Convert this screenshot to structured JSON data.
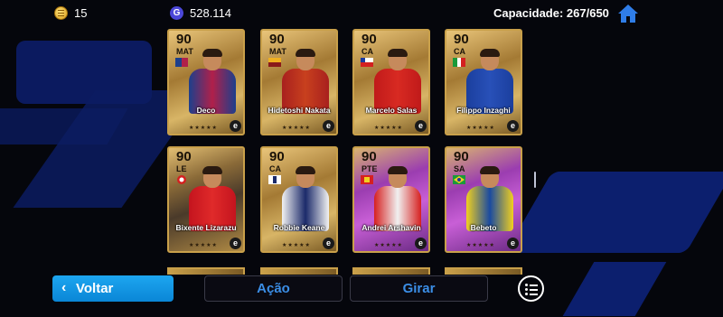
{
  "currency": {
    "coins": "15",
    "gp": "528.114",
    "gp_icon_label": "G"
  },
  "capacity": "Capacidade: 267/650",
  "cards": [
    {
      "rating": "90",
      "position": "MAT",
      "name": "Deco",
      "flag": "barcelona-crest",
      "jersey": "#1d3f8c",
      "jersey2": "#b0204a",
      "style": "gold"
    },
    {
      "rating": "90",
      "position": "MAT",
      "name": "Hidetoshi Nakata",
      "flag": "roma-crest",
      "jersey": "#a8201e",
      "jersey2": "#c8401e",
      "style": "gold"
    },
    {
      "rating": "90",
      "position": "CA",
      "name": "Marcelo Salas",
      "flag": "chile",
      "jersey": "#c01a1a",
      "jersey2": "#d82a22",
      "style": "gold"
    },
    {
      "rating": "90",
      "position": "CA",
      "name": "Filippo Inzaghi",
      "flag": "italy",
      "jersey": "#1b3f9e",
      "jersey2": "#2850b8",
      "style": "gold"
    },
    {
      "rating": "90",
      "position": "LE",
      "name": "Bixente Lizarazu",
      "flag": "bayern-crest",
      "jersey": "#c4141e",
      "jersey2": "#e02a2a",
      "style": "dark"
    },
    {
      "rating": "90",
      "position": "CA",
      "name": "Robbie Keane",
      "flag": "tottenham-crest",
      "jersey": "#f2f2f2",
      "jersey2": "#1b2a6a",
      "style": "gold"
    },
    {
      "rating": "90",
      "position": "PTE",
      "name": "Andrei Arshavin",
      "flag": "arsenal-crest",
      "jersey": "#d62020",
      "jersey2": "#f0f0f0",
      "style": "purple"
    },
    {
      "rating": "90",
      "position": "SA",
      "name": "Bebeto",
      "flag": "brazil",
      "jersey": "#f0d020",
      "jersey2": "#1a4aa0",
      "style": "purple"
    }
  ],
  "card_stars": "★★★★★",
  "card_badge": "e",
  "buttons": {
    "back": "Voltar",
    "action": "Ação",
    "rotate": "Girar"
  },
  "colors": {
    "accent_blue": "#1da6f0",
    "button_text": "#3b8ee6"
  }
}
